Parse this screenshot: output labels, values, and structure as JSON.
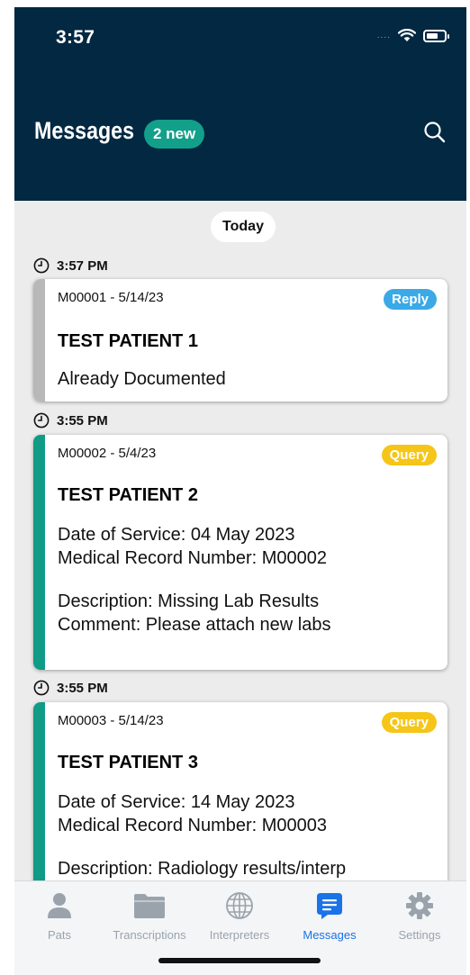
{
  "status_bar": {
    "time": "3:57",
    "signal_dots": "....",
    "wifi_icon": "wifi-icon",
    "battery_icon": "battery-icon"
  },
  "header": {
    "title": "Messages",
    "new_badge": "2 new",
    "search_icon": "search-icon"
  },
  "date_separator": "Today",
  "messages": [
    {
      "time": "3:57 PM",
      "id_date": "M00001 - 5/14/23",
      "tag": "Reply",
      "tag_color": "#3aa9e6",
      "bar_color": "#b8b8b8",
      "patient": "TEST PATIENT 1",
      "lines": [
        "Already Documented"
      ]
    },
    {
      "time": "3:55 PM",
      "id_date": "M00002 - 5/4/23",
      "tag": "Query",
      "tag_color": "#f5c518",
      "bar_color": "#0f9b86",
      "patient": "TEST PATIENT 2",
      "lines": [
        "Date of Service: 04 May 2023",
        "Medical Record Number: M00002",
        "Description: Missing Lab Results",
        "Comment: Please attach new labs"
      ]
    },
    {
      "time": "3:55 PM",
      "id_date": "M00003 - 5/14/23",
      "tag": "Query",
      "tag_color": "#f5c518",
      "bar_color": "#0f9b86",
      "patient": "TEST PATIENT 3",
      "lines": [
        "Date of Service: 14 May 2023",
        "Medical Record Number: M00003",
        "Description: Radiology results/interp"
      ]
    }
  ],
  "tabs": [
    {
      "label": "Pats",
      "icon": "person-icon",
      "active": false
    },
    {
      "label": "Transcriptions",
      "icon": "folder-icon",
      "active": false
    },
    {
      "label": "Interpreters",
      "icon": "globe-icon",
      "active": false
    },
    {
      "label": "Messages",
      "icon": "message-icon",
      "active": true
    },
    {
      "label": "Settings",
      "icon": "gear-icon",
      "active": false
    }
  ],
  "colors": {
    "header_bg": "#022842",
    "accent_teal": "#12a08a",
    "active_tab": "#1a73e8",
    "inactive_tab": "#9aa3ab"
  }
}
